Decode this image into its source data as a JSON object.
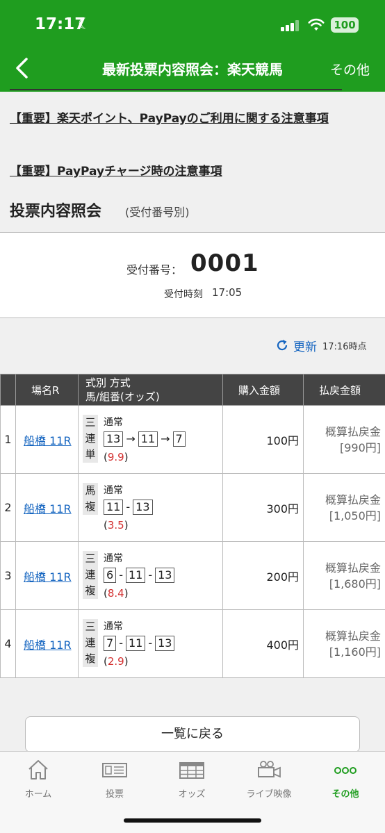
{
  "status": {
    "time": "17:17",
    "battery": "100"
  },
  "header": {
    "title": "最新投票内容照会：楽天競馬",
    "more": "その他"
  },
  "notices": [
    "【重要】楽天ポイント、PayPayのご利用に関する注意事項",
    "【重要】PayPayチャージ時の注意事項"
  ],
  "section": {
    "title": "投票内容照会",
    "subtitle": "(受付番号別)"
  },
  "receipt": {
    "number_label": "受付番号：",
    "number": "0001",
    "time_label": "受付時刻",
    "time": "17:05"
  },
  "refresh": {
    "label": "更新",
    "timestamp": "17:16時点"
  },
  "table": {
    "headers": {
      "venue": "場名R",
      "type_line1": "式別 方式",
      "type_line2": "馬/組番(オッズ)",
      "amount": "購入金額",
      "payout": "払戻金額"
    },
    "rows": [
      {
        "no": "1",
        "race": "船橋 11R",
        "bet_type": "三連単",
        "method": "通常",
        "combo": [
          "13",
          "11",
          "7"
        ],
        "sep": "→",
        "odds_open": "(",
        "odds": "9.9",
        "odds_close": ")",
        "amount": "100円",
        "payout_label": "概算払戻金",
        "payout": "[990円]"
      },
      {
        "no": "2",
        "race": "船橋 11R",
        "bet_type": "馬複",
        "method": "通常",
        "combo": [
          "11",
          "13"
        ],
        "sep": "-",
        "odds_open": "(",
        "odds": "3.5",
        "odds_close": ")",
        "amount": "300円",
        "payout_label": "概算払戻金",
        "payout": "[1,050円]"
      },
      {
        "no": "3",
        "race": "船橋 11R",
        "bet_type": "三連複",
        "method": "通常",
        "combo": [
          "6",
          "11",
          "13"
        ],
        "sep": "-",
        "odds_open": "(",
        "odds": "8.4",
        "odds_close": ")",
        "amount": "200円",
        "payout_label": "概算払戻金",
        "payout": "[1,680円]"
      },
      {
        "no": "4",
        "race": "船橋 11R",
        "bet_type": "三連複",
        "method": "通常",
        "combo": [
          "7",
          "11",
          "13"
        ],
        "sep": "-",
        "odds_open": "(",
        "odds": "2.9",
        "odds_close": ")",
        "amount": "400円",
        "payout_label": "概算払戻金",
        "payout": "[1,160円]"
      }
    ]
  },
  "back_to_list": "一覧に戻る",
  "tabs": [
    {
      "label": "ホーム",
      "icon": "home-icon"
    },
    {
      "label": "投票",
      "icon": "ticket-icon"
    },
    {
      "label": "オッズ",
      "icon": "odds-board-icon"
    },
    {
      "label": "ライブ映像",
      "icon": "video-camera-icon"
    },
    {
      "label": "その他",
      "icon": "more-dots-icon"
    }
  ],
  "colors": {
    "brand": "#1f9d1f",
    "link": "#1565c0",
    "odds": "#d32f2f",
    "table_header": "#444444"
  }
}
